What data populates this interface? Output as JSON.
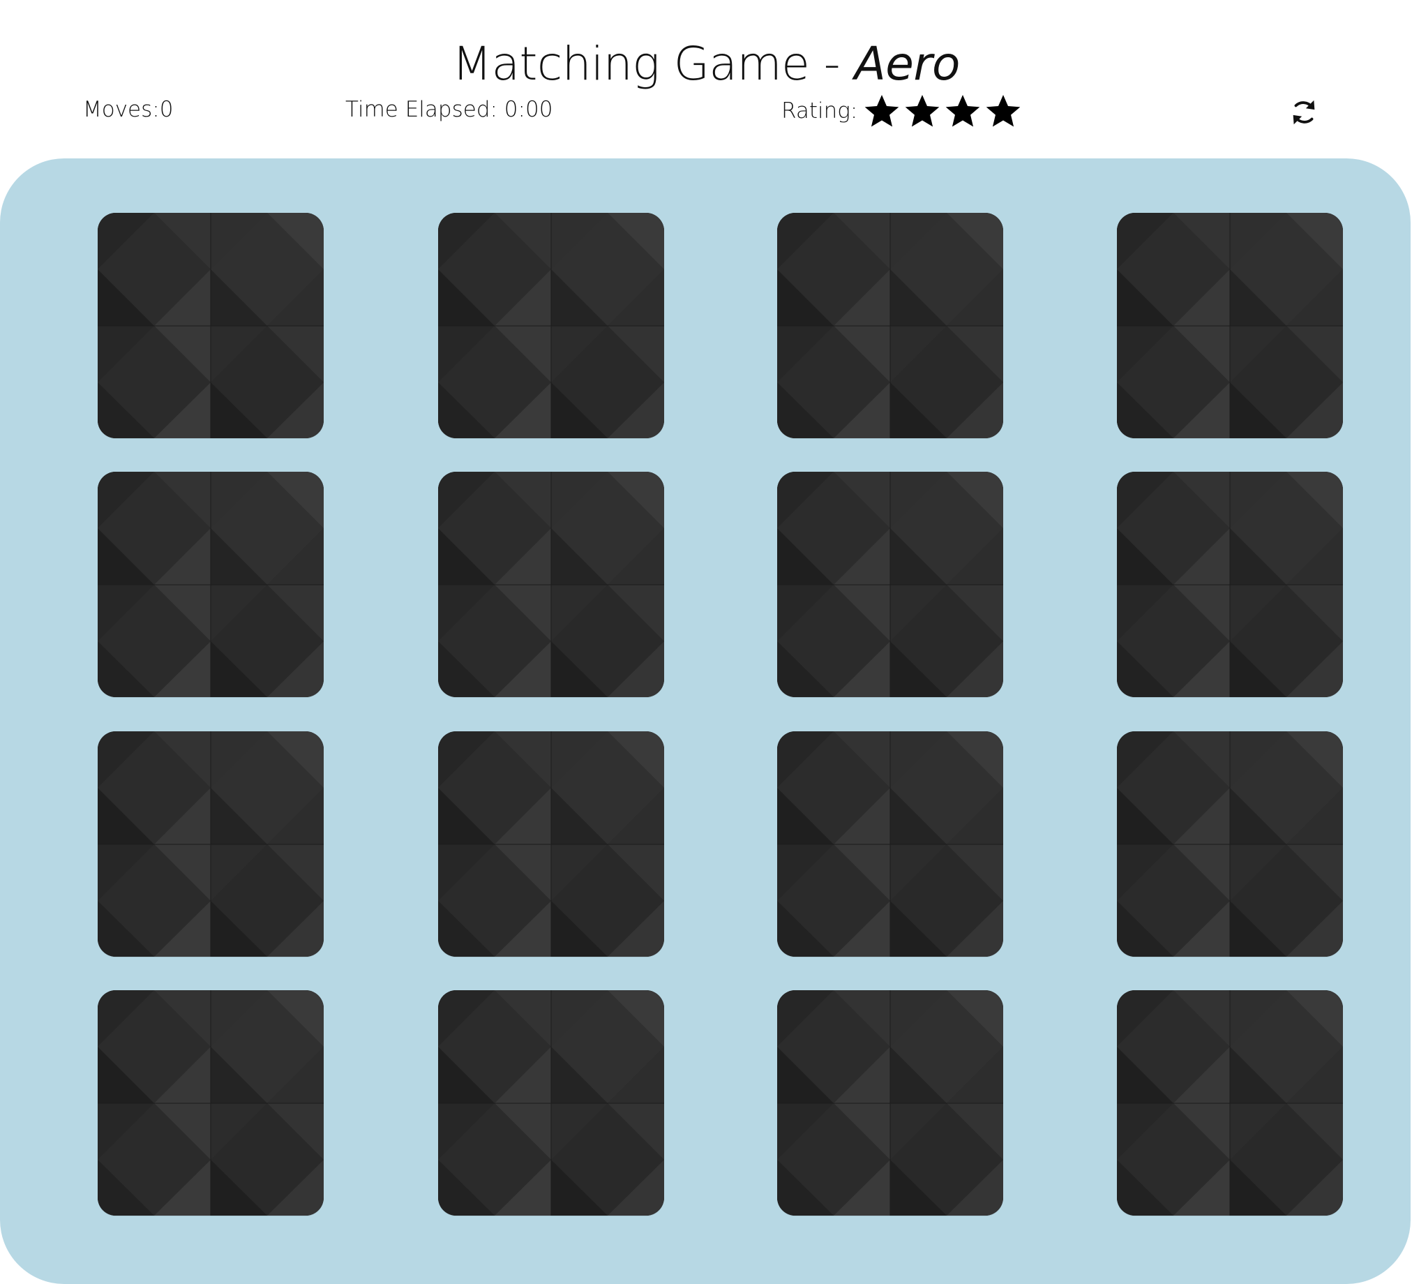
{
  "header": {
    "title_prefix": "Matching Game - ",
    "title_game": "Aero"
  },
  "stats": {
    "moves_label": "Moves:",
    "moves_value": "0",
    "time_label": "Time Elapsed: ",
    "time_value": "0:00",
    "rating_label": "Rating:",
    "rating_stars": 4,
    "restart_icon": "restart-icon"
  },
  "deck": {
    "rows": 4,
    "cols": 4,
    "card_state": "face-down",
    "card_count": 16
  },
  "colors": {
    "deck_background": "#b7d8e4",
    "card_back": "#2b2b2b",
    "text": "#111111"
  }
}
